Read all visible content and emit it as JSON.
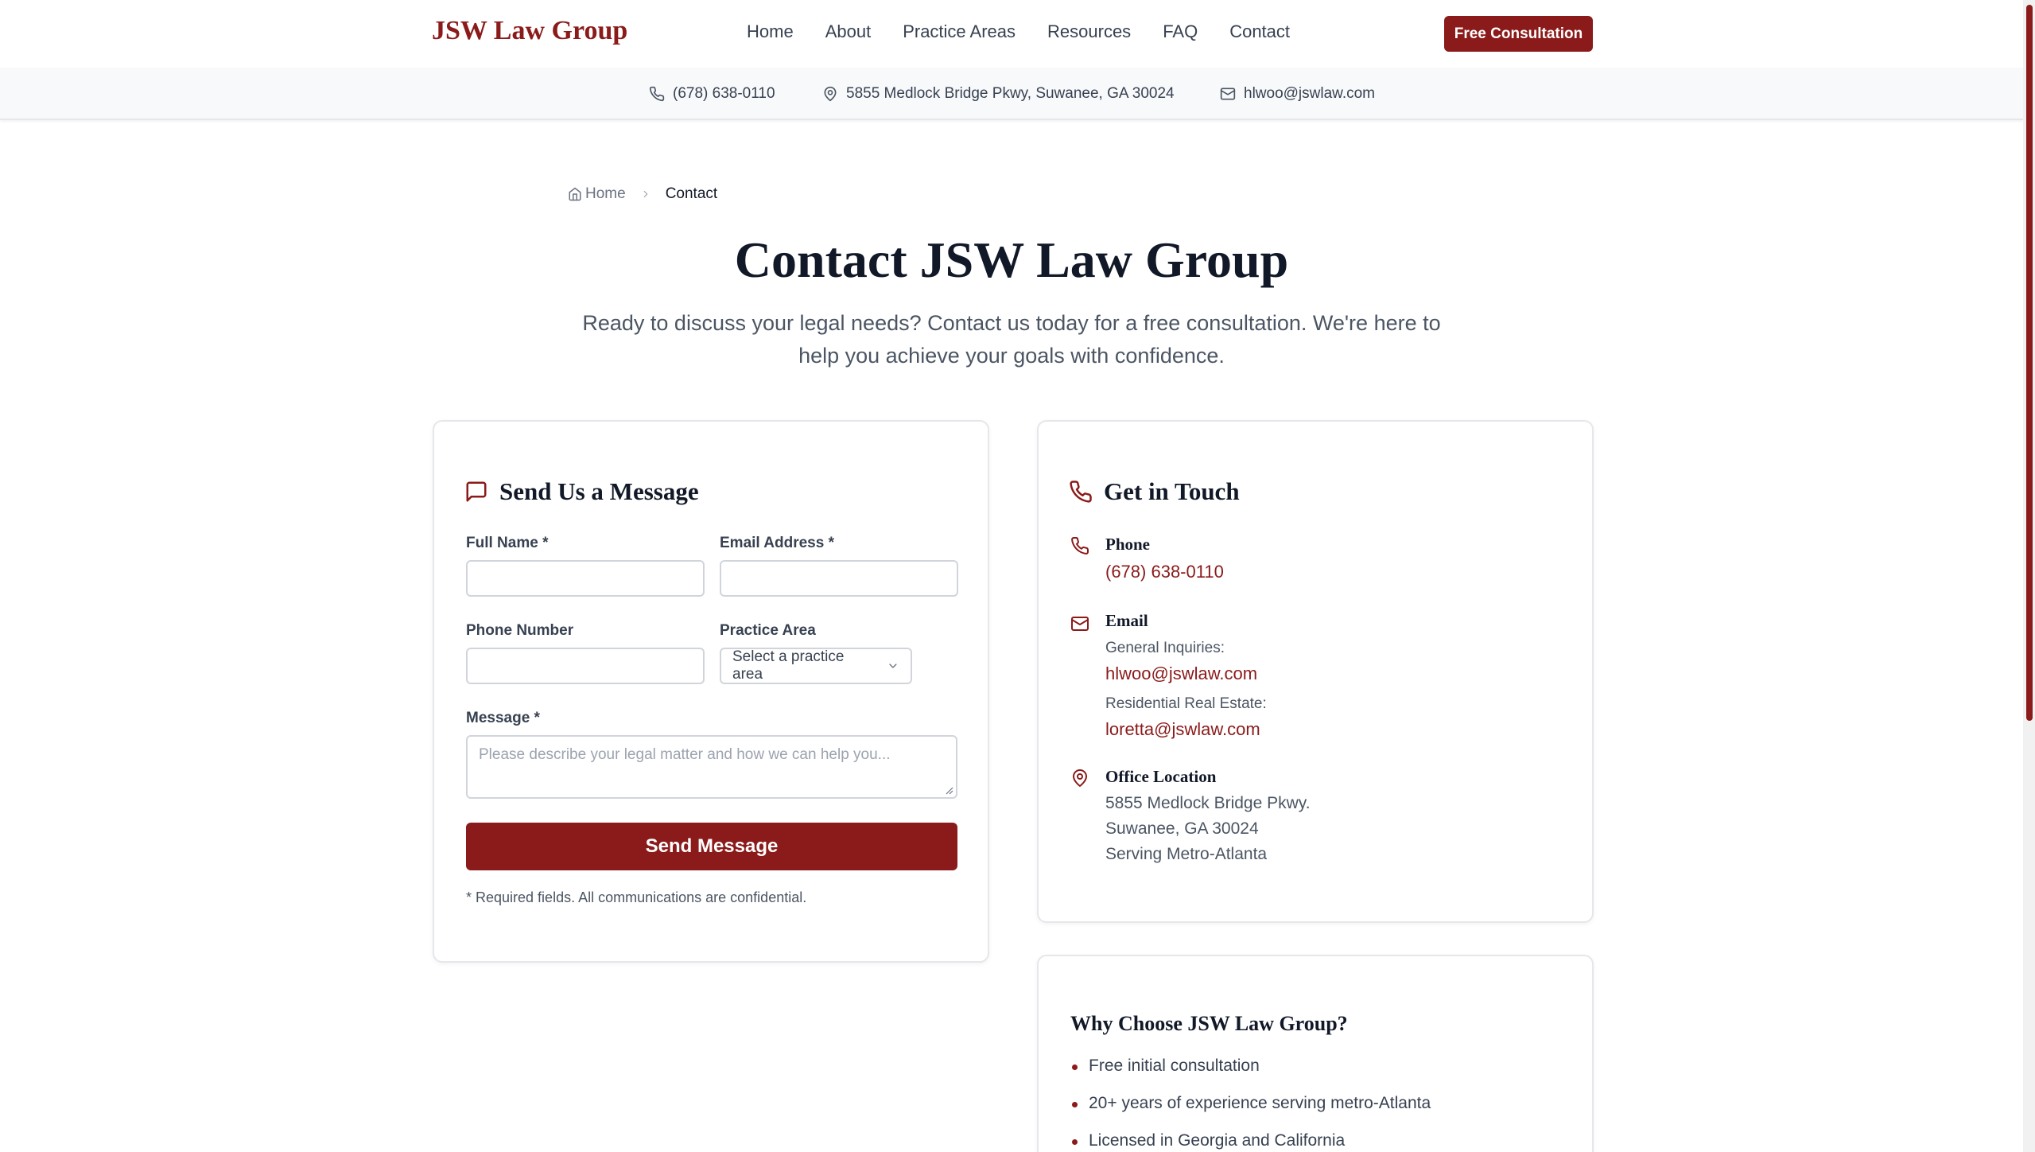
{
  "brand": {
    "name": "JSW Law Group",
    "accent": "#8b1a1a"
  },
  "nav": {
    "items": [
      "Home",
      "About",
      "Practice Areas",
      "Resources",
      "FAQ",
      "Contact"
    ],
    "cta": "Free Consultation"
  },
  "infobar": {
    "phone": "(678) 638-0110",
    "address": "5855 Medlock Bridge Pkwy, Suwanee, GA 30024",
    "email": "hlwoo@jswlaw.com"
  },
  "breadcrumb": {
    "home": "Home",
    "current": "Contact"
  },
  "page": {
    "title": "Contact JSW Law Group",
    "subtitle": "Ready to discuss your legal needs? Contact us today for a free consultation. We're here to help you achieve your goals with confidence."
  },
  "form": {
    "title": "Send Us a Message",
    "full_name_label": "Full Name *",
    "full_name_value": "",
    "email_label": "Email Address *",
    "email_value": "",
    "phone_label": "Phone Number",
    "phone_value": "",
    "practice_label": "Practice Area",
    "practice_selected": "Select a practice area",
    "message_label": "Message *",
    "message_placeholder": "Please describe your legal matter and how we can help you...",
    "submit": "Send Message",
    "note": "* Required fields. All communications are confidential."
  },
  "contact": {
    "title": "Get in Touch",
    "phone_heading": "Phone",
    "phone": "(678) 638-0110",
    "email_heading": "Email",
    "general_label": "General Inquiries:",
    "general_email": "hlwoo@jswlaw.com",
    "realestate_label": "Residential Real Estate:",
    "realestate_email": "loretta@jswlaw.com",
    "office_heading": "Office Location",
    "office_line1": "5855 Medlock Bridge Pkwy.",
    "office_line2": "Suwanee, GA 30024",
    "office_line3": "Serving Metro-Atlanta"
  },
  "why": {
    "title": "Why Choose JSW Law Group?",
    "items": [
      "Free initial consultation",
      "20+ years of experience serving metro-Atlanta",
      "Licensed in Georgia and California"
    ]
  }
}
